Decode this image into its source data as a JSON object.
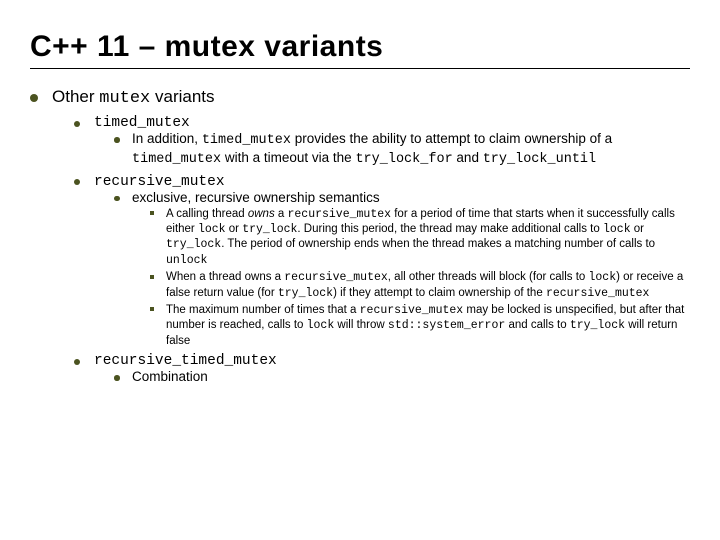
{
  "title": "C++ 11 – mutex variants",
  "root": {
    "text_pre": "Other ",
    "text_code": "mutex",
    "text_post": " variants"
  },
  "items": [
    {
      "head_code": "timed_mutex",
      "sub": {
        "p1": "In addition, ",
        "c1": "timed_mutex",
        "p2": " provides the ability to attempt to claim ownership of a ",
        "c2": "timed_mutex",
        "p3": " with a timeout via the ",
        "c3": "try_lock_for",
        "p4": " and ",
        "c4": "try_lock_until"
      }
    },
    {
      "head_code": "recursive_mutex",
      "sub_text": "exclusive, recursive ownership semantics",
      "deep": [
        {
          "p1": "A calling thread ",
          "i1": "owns",
          "p2": " a ",
          "c1": "recursive_mutex",
          "p3": " for a period of time that starts when it successfully calls either ",
          "c2": "lock",
          "p4": " or ",
          "c3": "try_lock",
          "p5": ". During this period, the thread may make additional calls to ",
          "c4": "lock",
          "p6": " or ",
          "c5": "try_lock",
          "p7": ". The period of ownership ends when the thread makes a matching number of calls to ",
          "c6": "unlock"
        },
        {
          "p1": "When a thread owns a ",
          "c1": "recursive_mutex",
          "p2": ", all other threads will block (for calls to ",
          "c2": "lock",
          "p3": ") or receive a false return value (for ",
          "c3": "try_lock",
          "p4": ") if they attempt to claim ownership of the ",
          "c4": "recursive_mutex"
        },
        {
          "p1": "The maximum number of times that a ",
          "c1": "recursive_mutex",
          "p2": " may be locked is unspecified, but after that number is reached, calls to ",
          "c2": "lock",
          "p3": " will throw ",
          "c3": "std::system_error",
          "p4": " and calls to ",
          "c4": "try_lock",
          "p5": " will return false"
        }
      ]
    },
    {
      "head_code": "recursive_timed_mutex",
      "sub_text": "Combination"
    }
  ]
}
